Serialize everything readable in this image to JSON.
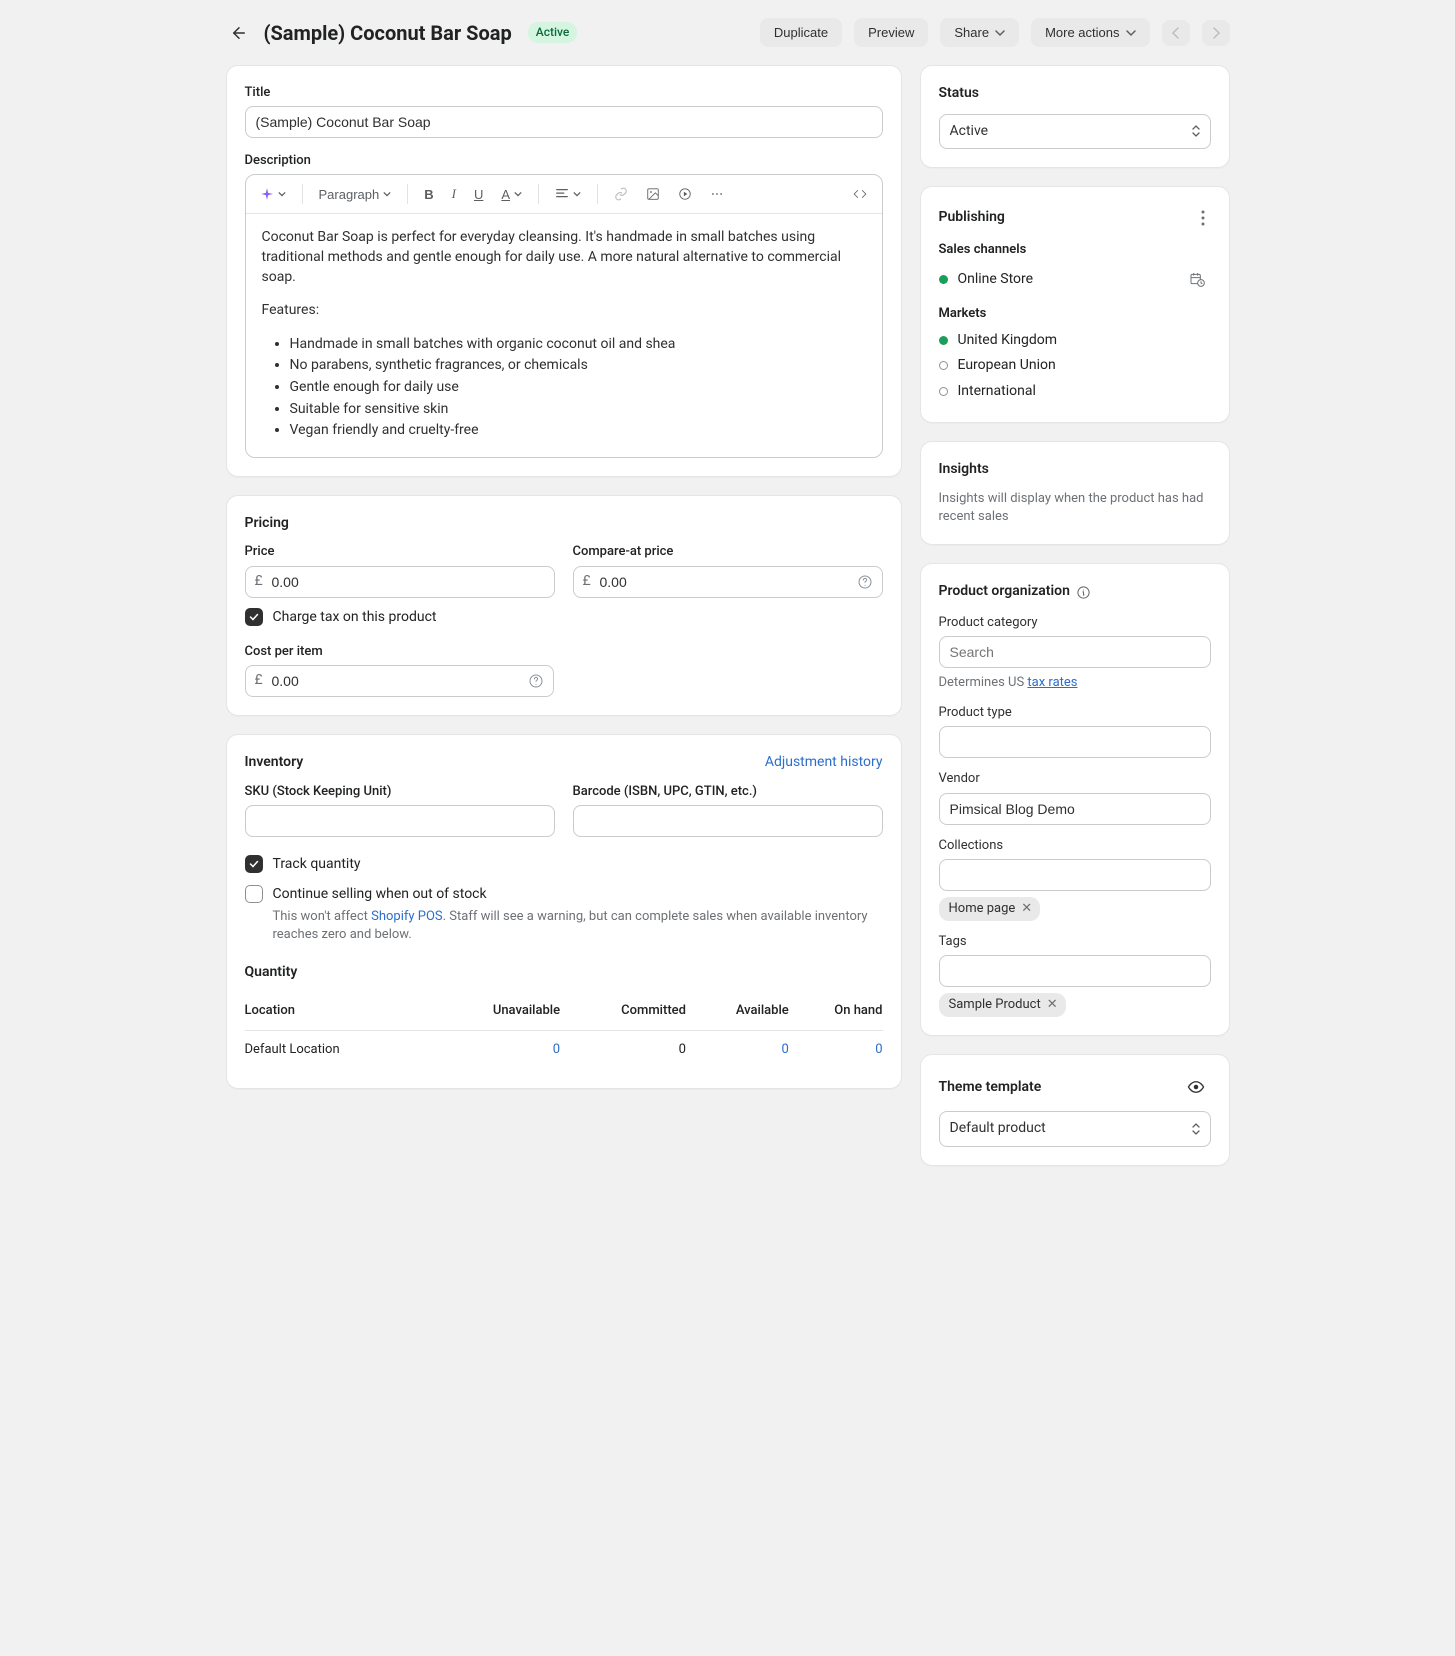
{
  "header": {
    "title": "(Sample) Coconut Bar Soap",
    "badge": "Active",
    "duplicate": "Duplicate",
    "preview": "Preview",
    "share": "Share",
    "more": "More actions"
  },
  "main": {
    "title_label": "Title",
    "title_value": "(Sample) Coconut Bar Soap",
    "description_label": "Description",
    "toolbar": {
      "paragraph": "Paragraph"
    },
    "description_paragraph": "Coconut Bar Soap is perfect for everyday cleansing. It's handmade in small batches using traditional methods and gentle enough for daily use. A more natural alternative to commercial soap.",
    "features_label": "Features:",
    "features": [
      "Handmade in small batches with organic coconut oil and shea",
      "No parabens, synthetic fragrances, or chemicals",
      "Gentle enough for daily use",
      "Suitable for sensitive skin",
      "Vegan friendly and cruelty-free"
    ]
  },
  "pricing": {
    "heading": "Pricing",
    "price_label": "Price",
    "price_value": "0.00",
    "currency": "£",
    "compare_label": "Compare-at price",
    "compare_value": "0.00",
    "tax_label": "Charge tax on this product",
    "cost_label": "Cost per item",
    "cost_value": "0.00"
  },
  "inventory": {
    "heading": "Inventory",
    "history_link": "Adjustment history",
    "sku_label": "SKU (Stock Keeping Unit)",
    "barcode_label": "Barcode (ISBN, UPC, GTIN, etc.)",
    "track_label": "Track quantity",
    "continue_label": "Continue selling when out of stock",
    "continue_hint_prefix": "This won't affect ",
    "continue_hint_link": "Shopify POS",
    "continue_hint_suffix": ". Staff will see a warning, but can complete sales when available inventory reaches zero and below.",
    "quantity_heading": "Quantity",
    "columns": {
      "location": "Location",
      "unavailable": "Unavailable",
      "committed": "Committed",
      "available": "Available",
      "on_hand": "On hand"
    },
    "row": {
      "location": "Default Location",
      "unavailable": "0",
      "committed": "0",
      "available": "0",
      "on_hand": "0"
    }
  },
  "status": {
    "heading": "Status",
    "value": "Active"
  },
  "publishing": {
    "heading": "Publishing",
    "channels_label": "Sales channels",
    "channel_online_store": "Online Store",
    "markets_label": "Markets",
    "market_uk": "United Kingdom",
    "market_eu": "European Union",
    "market_intl": "International"
  },
  "insights": {
    "heading": "Insights",
    "text": "Insights will display when the product has had recent sales"
  },
  "organization": {
    "heading": "Product organization",
    "category_label": "Product category",
    "category_placeholder": "Search",
    "category_hint_prefix": "Determines US ",
    "category_hint_link": "tax rates",
    "type_label": "Product type",
    "vendor_label": "Vendor",
    "vendor_value": "Pimsical Blog Demo",
    "collections_label": "Collections",
    "collection_tag": "Home page",
    "tags_label": "Tags",
    "tag_value": "Sample Product"
  },
  "template": {
    "heading": "Theme template",
    "value": "Default product"
  }
}
